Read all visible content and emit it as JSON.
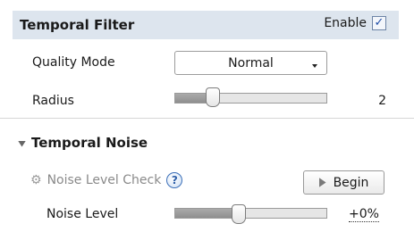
{
  "temporal_filter": {
    "title": "Temporal Filter",
    "enable_label": "Enable",
    "enable_checked": true,
    "check_mark": "✓",
    "quality_mode": {
      "label": "Quality Mode",
      "value": "Normal"
    },
    "radius": {
      "label": "Radius",
      "value": "2",
      "slider_fraction": 0.25
    }
  },
  "temporal_noise": {
    "title": "Temporal Noise",
    "noise_level_check": {
      "label": "Noise Level Check",
      "gear_icon": "gear-icon",
      "help_icon": "?",
      "begin_label": "Begin"
    },
    "noise_level": {
      "label": "Noise Level",
      "value": "+0%",
      "slider_fraction": 0.42
    }
  },
  "colors": {
    "header_bg": "#dde5ee",
    "accent": "#1f4da6"
  }
}
